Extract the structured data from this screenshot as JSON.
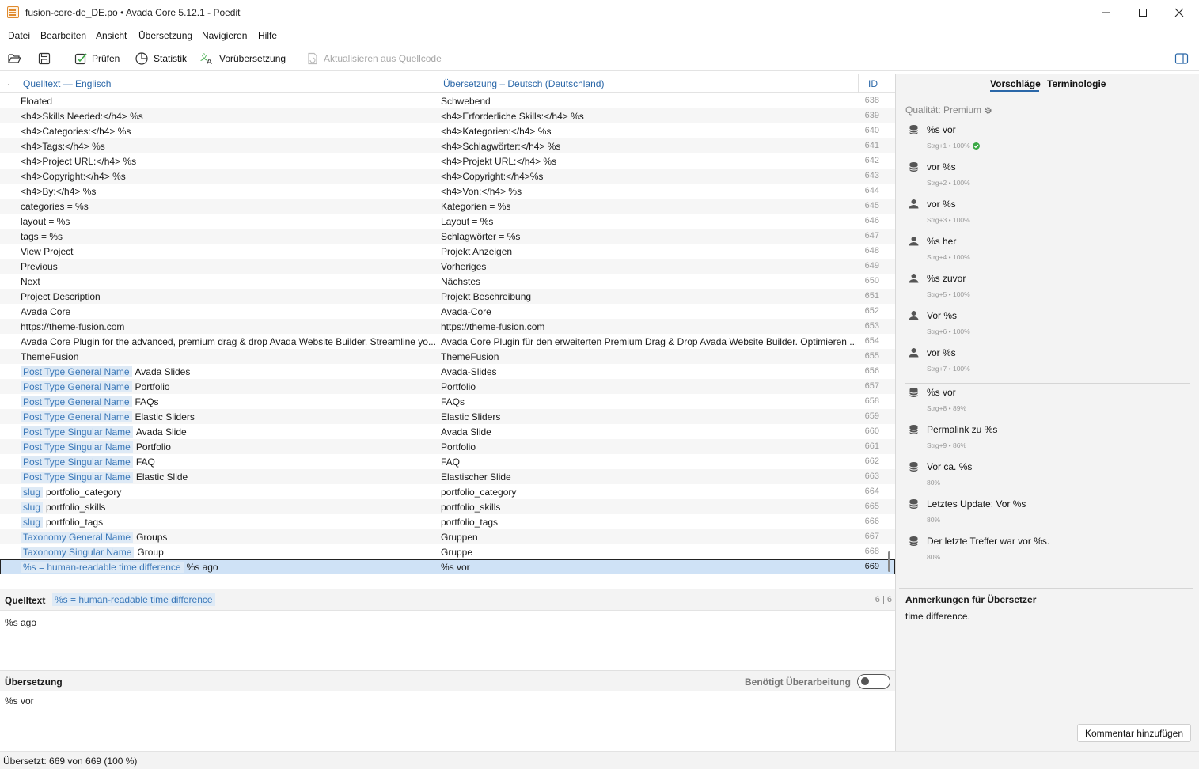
{
  "window": {
    "title": "fusion-core-de_DE.po • Avada Core 5.12.1 - Poedit"
  },
  "menu": [
    "Datei",
    "Bearbeiten",
    "Ansicht",
    "Übersetzung",
    "Navigieren",
    "Hilfe"
  ],
  "toolbar": {
    "validate": "Prüfen",
    "stats": "Statistik",
    "pretranslate": "Vorübersetzung",
    "update": "Aktualisieren aus Quellcode"
  },
  "columns": {
    "dot": "·",
    "source": "Quelltext — Englisch",
    "translation": "Übersetzung – Deutsch (Deutschland)",
    "id": "ID"
  },
  "rows": [
    {
      "ctx": "",
      "src": "Floated",
      "trn": "Schwebend",
      "id": "638"
    },
    {
      "ctx": "",
      "src": "<h4>Skills Needed:</h4> %s",
      "trn": "<h4>Erforderliche Skills:</h4> %s",
      "id": "639"
    },
    {
      "ctx": "",
      "src": "<h4>Categories:</h4> %s",
      "trn": "<h4>Kategorien:</h4> %s",
      "id": "640"
    },
    {
      "ctx": "",
      "src": "<h4>Tags:</h4> %s",
      "trn": "<h4>Schlagwörter:</h4> %s",
      "id": "641"
    },
    {
      "ctx": "",
      "src": "<h4>Project URL:</h4> %s",
      "trn": "<h4>Projekt URL:</h4> %s",
      "id": "642"
    },
    {
      "ctx": "",
      "src": "<h4>Copyright:</h4> %s",
      "trn": "<h4>Copyright:</h4>%s",
      "id": "643"
    },
    {
      "ctx": "",
      "src": "<h4>By:</h4> %s",
      "trn": "<h4>Von:</h4> %s",
      "id": "644"
    },
    {
      "ctx": "",
      "src": "categories = %s",
      "trn": "Kategorien = %s",
      "id": "645"
    },
    {
      "ctx": "",
      "src": "layout = %s",
      "trn": "Layout = %s",
      "id": "646"
    },
    {
      "ctx": "",
      "src": "tags = %s",
      "trn": "Schlagwörter = %s",
      "id": "647"
    },
    {
      "ctx": "",
      "src": "View Project",
      "trn": "Projekt Anzeigen",
      "id": "648"
    },
    {
      "ctx": "",
      "src": "Previous",
      "trn": "Vorheriges",
      "id": "649"
    },
    {
      "ctx": "",
      "src": "Next",
      "trn": "Nächstes",
      "id": "650"
    },
    {
      "ctx": "",
      "src": "Project Description",
      "trn": "Projekt Beschreibung",
      "id": "651"
    },
    {
      "ctx": "",
      "src": "Avada Core",
      "trn": "Avada-Core",
      "id": "652"
    },
    {
      "ctx": "",
      "src": "https://theme-fusion.com",
      "trn": "https://theme-fusion.com",
      "id": "653"
    },
    {
      "ctx": "",
      "src": "Avada Core Plugin for the advanced, premium drag & drop Avada Website Builder. Streamline yo...",
      "trn": "Avada Core Plugin für den erweiterten Premium Drag & Drop Avada Website Builder. Optimieren ...",
      "id": "654"
    },
    {
      "ctx": "",
      "src": "ThemeFusion",
      "trn": "ThemeFusion",
      "id": "655"
    },
    {
      "ctx": "Post Type General Name",
      "src": "Avada Slides",
      "trn": "Avada-Slides",
      "id": "656"
    },
    {
      "ctx": "Post Type General Name",
      "src": "Portfolio",
      "trn": "Portfolio",
      "id": "657"
    },
    {
      "ctx": "Post Type General Name",
      "src": "FAQs",
      "trn": "FAQs",
      "id": "658"
    },
    {
      "ctx": "Post Type General Name",
      "src": "Elastic Sliders",
      "trn": "Elastic Sliders",
      "id": "659"
    },
    {
      "ctx": "Post Type Singular Name",
      "src": "Avada Slide",
      "trn": "Avada Slide",
      "id": "660"
    },
    {
      "ctx": "Post Type Singular Name",
      "src": "Portfolio",
      "trn": "Portfolio",
      "id": "661"
    },
    {
      "ctx": "Post Type Singular Name",
      "src": "FAQ",
      "trn": "FAQ",
      "id": "662"
    },
    {
      "ctx": "Post Type Singular Name",
      "src": "Elastic Slide",
      "trn": "Elastischer Slide",
      "id": "663"
    },
    {
      "ctx": "slug",
      "src": "portfolio_category",
      "trn": "portfolio_category",
      "id": "664"
    },
    {
      "ctx": "slug",
      "src": "portfolio_skills",
      "trn": "portfolio_skills",
      "id": "665"
    },
    {
      "ctx": "slug",
      "src": "portfolio_tags",
      "trn": "portfolio_tags",
      "id": "666"
    },
    {
      "ctx": "Taxonomy General Name",
      "src": "Groups",
      "trn": "Gruppen",
      "id": "667"
    },
    {
      "ctx": "Taxonomy Singular Name",
      "src": "Group",
      "trn": "Gruppe",
      "id": "668"
    },
    {
      "ctx": "%s = human-readable time difference",
      "src": "%s ago",
      "trn": "%s vor",
      "id": "669",
      "selected": true
    }
  ],
  "source_pane": {
    "label": "Quelltext",
    "context": "%s = human-readable time difference",
    "count": "6 | 6",
    "text": "%s ago"
  },
  "translation_pane": {
    "label": "Übersetzung",
    "needs_work": "Benötigt Überarbeitung",
    "text": "%s vor"
  },
  "status": "Übersetzt: 669 von 669 (100 %)",
  "sidebar": {
    "tab_suggestions": "Vorschläge",
    "tab_terminology": "Terminologie",
    "quality": "Qualität: Premium",
    "suggestions": [
      {
        "icon": "database-icon",
        "text": "%s vor",
        "meta": "Strg+1 • 100%",
        "check": true
      },
      {
        "icon": "database-icon",
        "text": "vor %s",
        "meta": "Strg+2 • 100%"
      },
      {
        "icon": "person-icon",
        "text": "vor %s",
        "meta": "Strg+3 • 100%"
      },
      {
        "icon": "person-icon",
        "text": "%s her",
        "meta": "Strg+4 • 100%"
      },
      {
        "icon": "person-icon",
        "text": "%s zuvor",
        "meta": "Strg+5 • 100%"
      },
      {
        "icon": "person-icon",
        "text": "Vor %s",
        "meta": "Strg+6 • 100%"
      },
      {
        "icon": "person-icon",
        "text": "vor %s",
        "meta": "Strg+7 • 100%"
      },
      {
        "icon": "database-icon",
        "text": " %s vor",
        "meta": "Strg+8 • 89%"
      },
      {
        "icon": "database-icon",
        "text": "Permalink zu %s",
        "meta": "Strg+9 • 86%"
      },
      {
        "icon": "database-icon",
        "text": "Vor ca. %s",
        "meta": "80%"
      },
      {
        "icon": "database-icon",
        "text": "Letztes Update: Vor %s",
        "meta": "80%"
      },
      {
        "icon": "database-icon",
        "text": "Der letzte Treffer war vor %s.",
        "meta": "80%"
      }
    ],
    "notes_title": "Anmerkungen für Übersetzer",
    "notes_text": "time difference.",
    "add_comment": "Kommentar hinzufügen"
  },
  "colors": {
    "accent": "#2a67a8",
    "context_bg": "#deeaf6",
    "context_fg": "#3b78b8",
    "selected_bg": "#cfe2f6",
    "check": "#3aa844"
  }
}
